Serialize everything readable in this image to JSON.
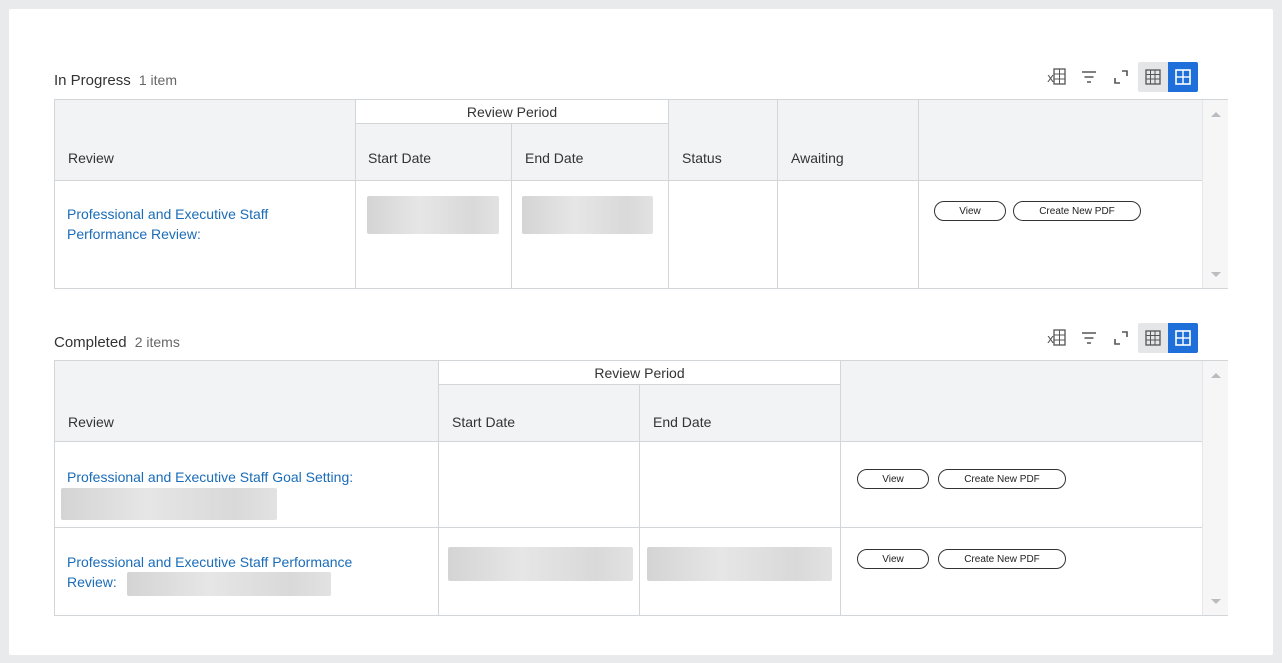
{
  "in_progress": {
    "title": "In Progress",
    "count": "1 item",
    "group_header": "Review Period",
    "columns": {
      "review": "Review",
      "start_date": "Start Date",
      "end_date": "End Date",
      "status": "Status",
      "awaiting": "Awaiting"
    },
    "rows": [
      {
        "review_line1": "Professional and Executive Staff",
        "review_line2": "Performance Review:",
        "view_label": "View",
        "pdf_label": "Create New PDF"
      }
    ]
  },
  "completed": {
    "title": "Completed",
    "count": "2 items",
    "group_header": "Review Period",
    "columns": {
      "review": "Review",
      "start_date": "Start Date",
      "end_date": "End Date"
    },
    "rows": [
      {
        "review_line1": "Professional and Executive Staff Goal Setting:",
        "review_line2": "",
        "view_label": "View",
        "pdf_label": "Create New PDF"
      },
      {
        "review_line1": "Professional and Executive Staff Performance",
        "review_line2": "Review:",
        "view_label": "View",
        "pdf_label": "Create New PDF"
      }
    ]
  },
  "icons": [
    "export-excel-icon",
    "filter-icon",
    "fullscreen-icon",
    "table-view-icon",
    "grid-view-icon"
  ],
  "colors": {
    "link": "#1a6cb8",
    "accent": "#1e6fd9",
    "header_bg": "#f2f3f4",
    "border": "#d3d6d9"
  }
}
